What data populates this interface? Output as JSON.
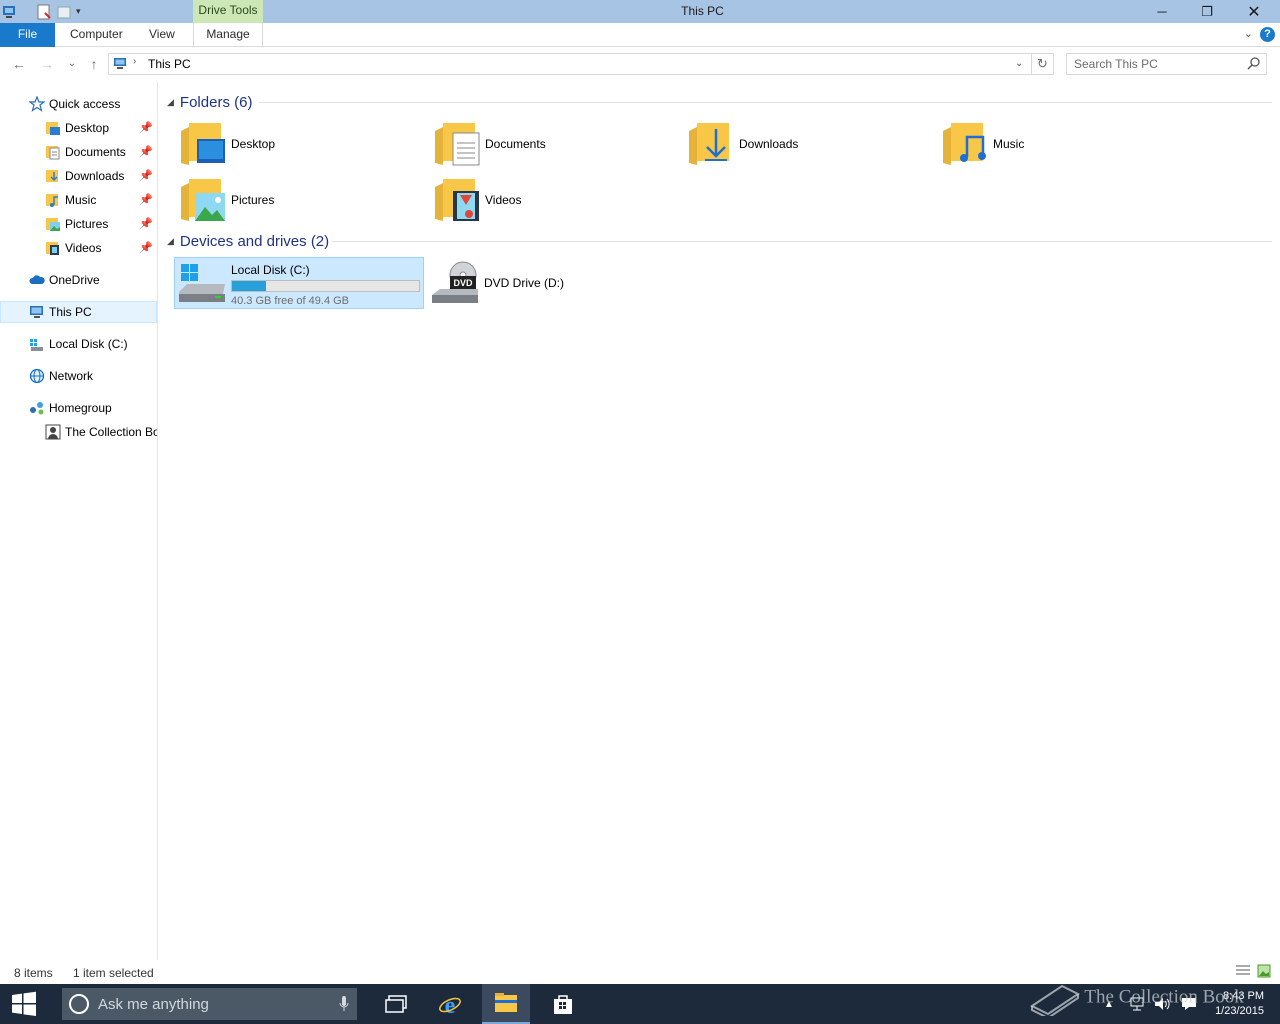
{
  "titlebar": {
    "title": "This PC",
    "context_tab": "Drive Tools",
    "buttons": {
      "minimize": "─",
      "maximize": "❐",
      "close": "✕"
    }
  },
  "ribbon": {
    "tabs": [
      {
        "label": "File"
      },
      {
        "label": "Computer"
      },
      {
        "label": "View"
      },
      {
        "label": "Manage"
      }
    ],
    "help": "?",
    "accent": "#1979ca"
  },
  "address": {
    "crumb": "This PC",
    "search_placeholder": "Search This PC"
  },
  "sidebar": {
    "quick_access": "Quick access",
    "quick_items": [
      {
        "label": "Desktop",
        "icon": "desktop-folder-icon"
      },
      {
        "label": "Documents",
        "icon": "documents-folder-icon"
      },
      {
        "label": "Downloads",
        "icon": "downloads-folder-icon"
      },
      {
        "label": "Music",
        "icon": "music-folder-icon"
      },
      {
        "label": "Pictures",
        "icon": "pictures-folder-icon"
      },
      {
        "label": "Videos",
        "icon": "videos-folder-icon"
      }
    ],
    "onedrive": "OneDrive",
    "this_pc": "This PC",
    "local_disk": "Local Disk (C:)",
    "network": "Network",
    "homegroup": "Homegroup",
    "homegroup_user": "The Collection Bo"
  },
  "content": {
    "folders_header": "Folders (6)",
    "folders": [
      {
        "label": "Desktop",
        "icon": "desktop-folder-icon"
      },
      {
        "label": "Documents",
        "icon": "documents-folder-icon"
      },
      {
        "label": "Downloads",
        "icon": "downloads-folder-icon"
      },
      {
        "label": "Music",
        "icon": "music-folder-icon"
      },
      {
        "label": "Pictures",
        "icon": "pictures-folder-icon"
      },
      {
        "label": "Videos",
        "icon": "videos-folder-icon"
      }
    ],
    "devices_header": "Devices and drives (2)",
    "drives": [
      {
        "label": "Local Disk (C:)",
        "free_text": "40.3 GB free of 49.4 GB",
        "used_fraction": 0.18,
        "selected": true
      },
      {
        "label": "DVD Drive (D:)",
        "selected": false
      }
    ]
  },
  "status": {
    "items": "8 items",
    "selection": "1 item selected"
  },
  "taskbar": {
    "search_placeholder": "Ask me anything",
    "time": "8:43 PM",
    "date": "1/23/2015",
    "watermark": "The Collection Book"
  },
  "colors": {
    "folder_yellow": "#f8c748",
    "selection_fill": "#cce8ff",
    "taskbar": "#1c2a3b"
  }
}
